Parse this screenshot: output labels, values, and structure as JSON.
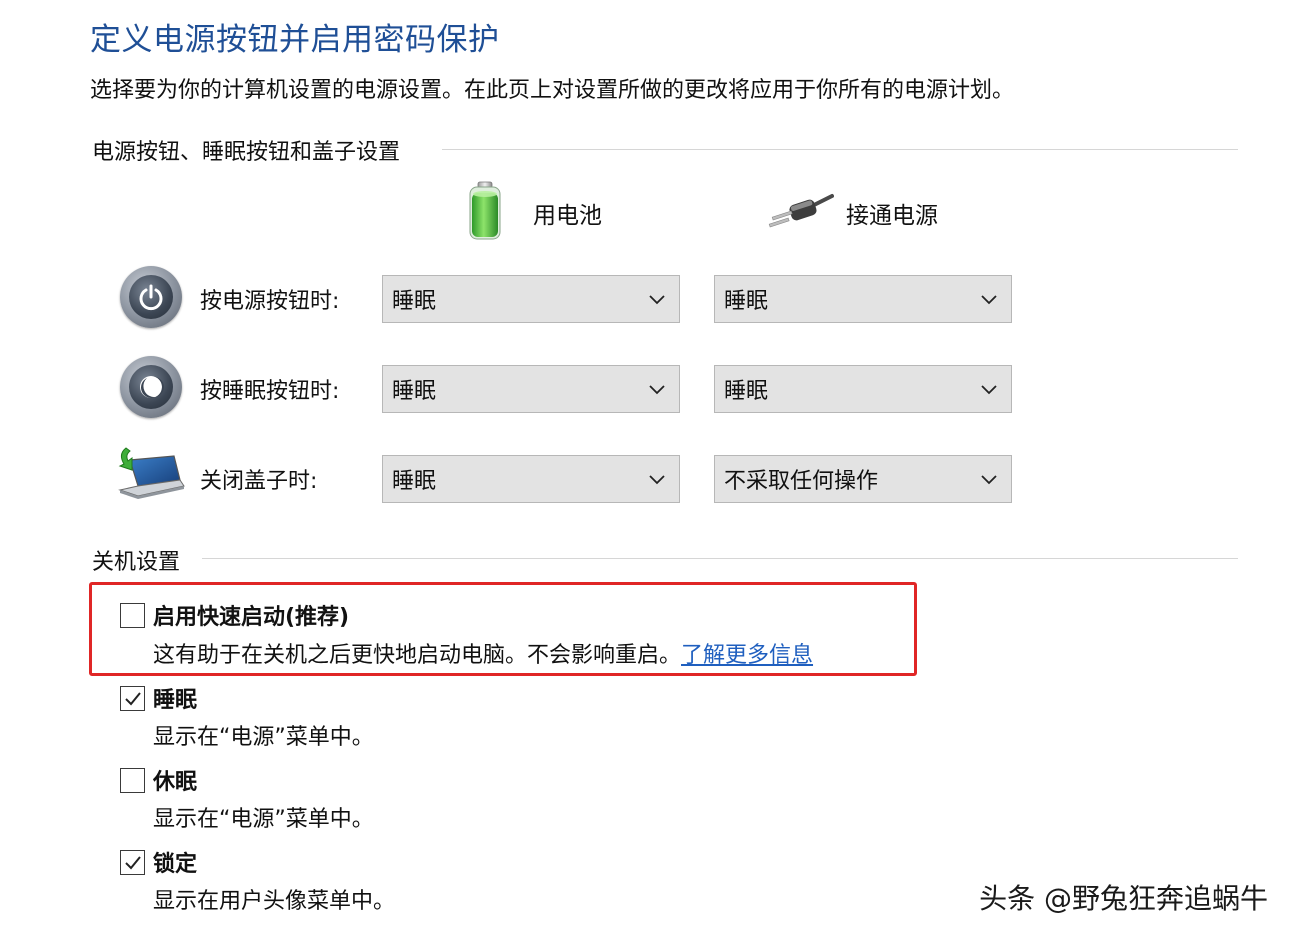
{
  "page": {
    "title": "定义电源按钮并启用密码保护",
    "description": "选择要为你的计算机设置的电源设置。在此页上对设置所做的更改将应用于你所有的电源计划。"
  },
  "buttons_section": {
    "heading": "电源按钮、睡眠按钮和盖子设置",
    "columns": {
      "battery": "用电池",
      "plugged": "接通电源"
    },
    "rows": [
      {
        "label": "按电源按钮时:",
        "icon": "power-button-icon",
        "battery": "睡眠",
        "plugged": "睡眠"
      },
      {
        "label": "按睡眠按钮时:",
        "icon": "sleep-button-icon",
        "battery": "睡眠",
        "plugged": "睡眠"
      },
      {
        "label": "关闭盖子时:",
        "icon": "laptop-lid-icon",
        "battery": "睡眠",
        "plugged": "不采取任何操作"
      }
    ]
  },
  "shutdown_section": {
    "heading": "关机设置",
    "options": [
      {
        "title": "启用快速启动(推荐)",
        "desc": "这有助于在关机之后更快地启动电脑。不会影响重启。",
        "link": "了解更多信息",
        "checked": false
      },
      {
        "title": "睡眠",
        "desc": "显示在“电源”菜单中。",
        "checked": true
      },
      {
        "title": "休眠",
        "desc": "显示在“电源”菜单中。",
        "checked": false
      },
      {
        "title": "锁定",
        "desc": "显示在用户头像菜单中。",
        "checked": true
      }
    ]
  },
  "highlight_color": "#e02626",
  "accent_color": "#1f4f96",
  "watermark": "头条 @野兔狂奔追蜗牛"
}
